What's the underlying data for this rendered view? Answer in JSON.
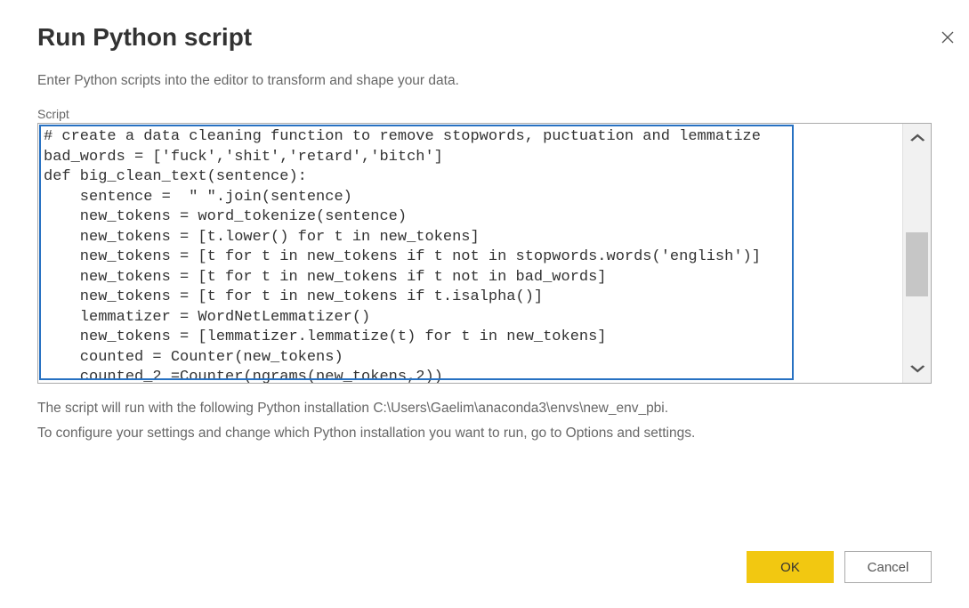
{
  "dialog": {
    "title": "Run Python script",
    "subtitle": "Enter Python scripts into the editor to transform and shape your data.",
    "script_label": "Script",
    "code": "# create a data cleaning function to remove stopwords, puctuation and lemmatize\nbad_words = ['fuck','shit','retard','bitch']\ndef big_clean_text(sentence):\n    sentence =  \" \".join(sentence)\n    new_tokens = word_tokenize(sentence)\n    new_tokens = [t.lower() for t in new_tokens]\n    new_tokens = [t for t in new_tokens if t not in stopwords.words('english')]\n    new_tokens = [t for t in new_tokens if t not in bad_words]\n    new_tokens = [t for t in new_tokens if t.isalpha()]\n    lemmatizer = WordNetLemmatizer()\n    new_tokens = [lemmatizer.lemmatize(t) for t in new_tokens]\n    counted = Counter(new_tokens)\n    counted_2 =Counter(ngrams(new_tokens,2))",
    "footer_line1": "The script will run with the following Python installation C:\\Users\\Gaelim\\anaconda3\\envs\\new_env_pbi.",
    "footer_line2": "To configure your settings and change which Python installation you want to run, go to Options and settings.",
    "ok_label": "OK",
    "cancel_label": "Cancel"
  }
}
